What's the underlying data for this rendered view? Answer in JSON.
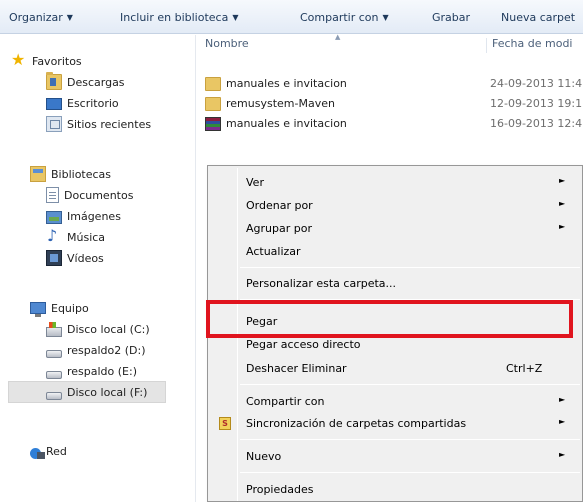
{
  "toolbar": {
    "organize": "Organizar",
    "include": "Incluir en biblioteca",
    "share": "Compartir con",
    "burn": "Grabar",
    "new_folder": "Nueva carpet"
  },
  "nav": {
    "favorites": "Favoritos",
    "downloads": "Descargas",
    "desktop": "Escritorio",
    "recent": "Sitios recientes",
    "libraries": "Bibliotecas",
    "documents": "Documentos",
    "images": "Imágenes",
    "music": "Música",
    "videos": "Vídeos",
    "computer": "Equipo",
    "disk_c": "Disco local (C:)",
    "respaldo2": "respaldo2 (D:)",
    "respaldo": "respaldo (E:)",
    "disk_f": "Disco local (F:)",
    "network": "Red"
  },
  "columns": {
    "name": "Nombre",
    "date": "Fecha de modi"
  },
  "files": [
    {
      "name": "manuales e invitacion",
      "date": "24-09-2013 11:4"
    },
    {
      "name": "remusystem-Maven",
      "date": "12-09-2013 19:1"
    },
    {
      "name": "manuales e invitacion",
      "date": "16-09-2013 12:4"
    }
  ],
  "menu": {
    "view": "Ver",
    "sort_by": "Ordenar por",
    "group_by": "Agrupar por",
    "refresh": "Actualizar",
    "customize": "Personalizar esta carpeta...",
    "paste": "Pegar",
    "paste_shortcut": "Pegar acceso directo",
    "undo_delete": "Deshacer Eliminar",
    "undo_shortcut": "Ctrl+Z",
    "share_with": "Compartir con",
    "sync": "Sincronización de carpetas compartidas",
    "new": "Nuevo",
    "properties": "Propiedades",
    "submenu_arrow": "►"
  },
  "colors": {
    "highlight_border": "#e0141e",
    "toolbar_text": "#1e395b",
    "menu_bg": "#f0f0f0"
  }
}
